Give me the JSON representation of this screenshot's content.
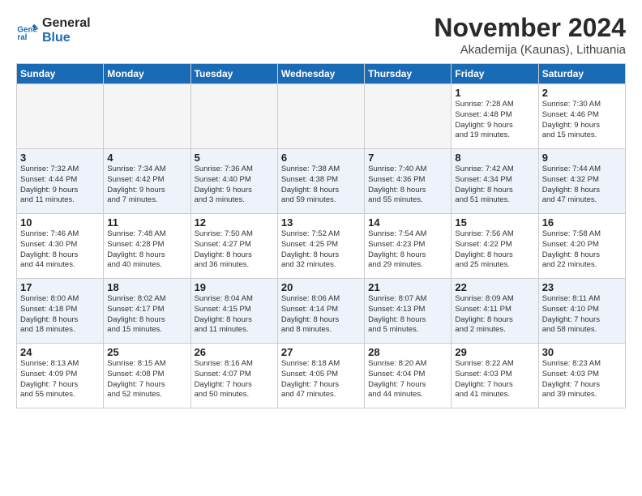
{
  "header": {
    "logo_line1": "General",
    "logo_line2": "Blue",
    "title": "November 2024",
    "location": "Akademija (Kaunas), Lithuania"
  },
  "weekdays": [
    "Sunday",
    "Monday",
    "Tuesday",
    "Wednesday",
    "Thursday",
    "Friday",
    "Saturday"
  ],
  "weeks": [
    [
      {
        "day": "",
        "info": ""
      },
      {
        "day": "",
        "info": ""
      },
      {
        "day": "",
        "info": ""
      },
      {
        "day": "",
        "info": ""
      },
      {
        "day": "",
        "info": ""
      },
      {
        "day": "1",
        "info": "Sunrise: 7:28 AM\nSunset: 4:48 PM\nDaylight: 9 hours\nand 19 minutes."
      },
      {
        "day": "2",
        "info": "Sunrise: 7:30 AM\nSunset: 4:46 PM\nDaylight: 9 hours\nand 15 minutes."
      }
    ],
    [
      {
        "day": "3",
        "info": "Sunrise: 7:32 AM\nSunset: 4:44 PM\nDaylight: 9 hours\nand 11 minutes."
      },
      {
        "day": "4",
        "info": "Sunrise: 7:34 AM\nSunset: 4:42 PM\nDaylight: 9 hours\nand 7 minutes."
      },
      {
        "day": "5",
        "info": "Sunrise: 7:36 AM\nSunset: 4:40 PM\nDaylight: 9 hours\nand 3 minutes."
      },
      {
        "day": "6",
        "info": "Sunrise: 7:38 AM\nSunset: 4:38 PM\nDaylight: 8 hours\nand 59 minutes."
      },
      {
        "day": "7",
        "info": "Sunrise: 7:40 AM\nSunset: 4:36 PM\nDaylight: 8 hours\nand 55 minutes."
      },
      {
        "day": "8",
        "info": "Sunrise: 7:42 AM\nSunset: 4:34 PM\nDaylight: 8 hours\nand 51 minutes."
      },
      {
        "day": "9",
        "info": "Sunrise: 7:44 AM\nSunset: 4:32 PM\nDaylight: 8 hours\nand 47 minutes."
      }
    ],
    [
      {
        "day": "10",
        "info": "Sunrise: 7:46 AM\nSunset: 4:30 PM\nDaylight: 8 hours\nand 44 minutes."
      },
      {
        "day": "11",
        "info": "Sunrise: 7:48 AM\nSunset: 4:28 PM\nDaylight: 8 hours\nand 40 minutes."
      },
      {
        "day": "12",
        "info": "Sunrise: 7:50 AM\nSunset: 4:27 PM\nDaylight: 8 hours\nand 36 minutes."
      },
      {
        "day": "13",
        "info": "Sunrise: 7:52 AM\nSunset: 4:25 PM\nDaylight: 8 hours\nand 32 minutes."
      },
      {
        "day": "14",
        "info": "Sunrise: 7:54 AM\nSunset: 4:23 PM\nDaylight: 8 hours\nand 29 minutes."
      },
      {
        "day": "15",
        "info": "Sunrise: 7:56 AM\nSunset: 4:22 PM\nDaylight: 8 hours\nand 25 minutes."
      },
      {
        "day": "16",
        "info": "Sunrise: 7:58 AM\nSunset: 4:20 PM\nDaylight: 8 hours\nand 22 minutes."
      }
    ],
    [
      {
        "day": "17",
        "info": "Sunrise: 8:00 AM\nSunset: 4:18 PM\nDaylight: 8 hours\nand 18 minutes."
      },
      {
        "day": "18",
        "info": "Sunrise: 8:02 AM\nSunset: 4:17 PM\nDaylight: 8 hours\nand 15 minutes."
      },
      {
        "day": "19",
        "info": "Sunrise: 8:04 AM\nSunset: 4:15 PM\nDaylight: 8 hours\nand 11 minutes."
      },
      {
        "day": "20",
        "info": "Sunrise: 8:06 AM\nSunset: 4:14 PM\nDaylight: 8 hours\nand 8 minutes."
      },
      {
        "day": "21",
        "info": "Sunrise: 8:07 AM\nSunset: 4:13 PM\nDaylight: 8 hours\nand 5 minutes."
      },
      {
        "day": "22",
        "info": "Sunrise: 8:09 AM\nSunset: 4:11 PM\nDaylight: 8 hours\nand 2 minutes."
      },
      {
        "day": "23",
        "info": "Sunrise: 8:11 AM\nSunset: 4:10 PM\nDaylight: 7 hours\nand 58 minutes."
      }
    ],
    [
      {
        "day": "24",
        "info": "Sunrise: 8:13 AM\nSunset: 4:09 PM\nDaylight: 7 hours\nand 55 minutes."
      },
      {
        "day": "25",
        "info": "Sunrise: 8:15 AM\nSunset: 4:08 PM\nDaylight: 7 hours\nand 52 minutes."
      },
      {
        "day": "26",
        "info": "Sunrise: 8:16 AM\nSunset: 4:07 PM\nDaylight: 7 hours\nand 50 minutes."
      },
      {
        "day": "27",
        "info": "Sunrise: 8:18 AM\nSunset: 4:05 PM\nDaylight: 7 hours\nand 47 minutes."
      },
      {
        "day": "28",
        "info": "Sunrise: 8:20 AM\nSunset: 4:04 PM\nDaylight: 7 hours\nand 44 minutes."
      },
      {
        "day": "29",
        "info": "Sunrise: 8:22 AM\nSunset: 4:03 PM\nDaylight: 7 hours\nand 41 minutes."
      },
      {
        "day": "30",
        "info": "Sunrise: 8:23 AM\nSunset: 4:03 PM\nDaylight: 7 hours\nand 39 minutes."
      }
    ]
  ]
}
